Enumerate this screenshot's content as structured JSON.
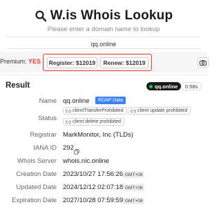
{
  "header": {
    "title": "W.is Whois Lookup",
    "subtitle": "Please enter a domain name to lookup"
  },
  "search": {
    "value": "qq.online"
  },
  "pricing": {
    "premium_label": "Premium:",
    "premium_value": "YES",
    "register_label": "Register: $12019",
    "renew_label": "Renew: $12019"
  },
  "result": {
    "title": "Result",
    "domain_badge": "qq.online",
    "query_time": "0.58s",
    "rows": {
      "name": {
        "label": "Name",
        "value": "qq.online",
        "badge": "RDAP Data"
      },
      "status": {
        "label": "Status",
        "items": [
          "clientTransferProhibited",
          "client update prohibited",
          "client delete prohibited"
        ]
      },
      "registrar": {
        "label": "Registrar",
        "value": "MarkMonitor, Inc (TLDs)"
      },
      "iana": {
        "label": "IANA ID",
        "value": "292"
      },
      "whois_server": {
        "label": "Whois Server",
        "value": "whois.nic.online"
      },
      "creation": {
        "label": "Creation Date",
        "value": "2023/10/27 17:56:26",
        "tz": "GMT+08"
      },
      "updated": {
        "label": "Updated Date",
        "value": "2024/12/12 02:07:18",
        "tz": "GMT+08"
      },
      "expiration": {
        "label": "Expiration Date",
        "value": "2027/10/28 07:59:59",
        "tz": "GMT+08"
      }
    }
  },
  "colors": {
    "highlight_red": "#e53935",
    "rdap_blue": "#3b82f6",
    "online_green": "#22c55e"
  },
  "icons": {
    "title": "search-icon",
    "camera": "camera-icon",
    "copy": "copy-icon",
    "status_link": "link-icon"
  }
}
